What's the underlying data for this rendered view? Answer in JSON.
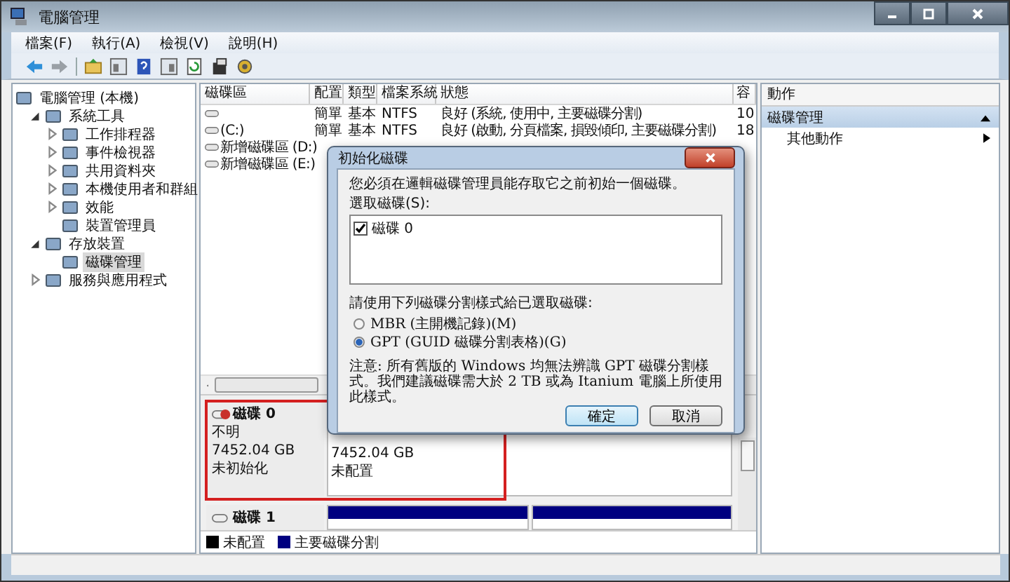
{
  "window": {
    "title": "電腦管理"
  },
  "menu": [
    "檔案(F)",
    "執行(A)",
    "檢視(V)",
    "說明(H)"
  ],
  "tree": [
    {
      "label": "電腦管理 (本機)",
      "selected": false,
      "children": [
        {
          "label": "系統工具",
          "selected": false,
          "expanded": true,
          "children": [
            {
              "label": "工作排程器",
              "selected": false,
              "expanded": false
            },
            {
              "label": "事件檢視器",
              "selected": false,
              "expanded": false
            },
            {
              "label": "共用資料夾",
              "selected": false,
              "expanded": false
            },
            {
              "label": "本機使用者和群組",
              "selected": false,
              "expanded": false
            },
            {
              "label": "效能",
              "selected": false,
              "expanded": false
            },
            {
              "label": "裝置管理員",
              "selected": false
            }
          ]
        },
        {
          "label": "存放裝置",
          "selected": false,
          "expanded": true,
          "children": [
            {
              "label": "磁碟管理",
              "selected": true
            }
          ]
        },
        {
          "label": "服務與應用程式",
          "selected": false,
          "expanded": false
        }
      ]
    }
  ],
  "volumes": {
    "columns": [
      "磁碟區",
      "配置",
      "類型",
      "檔案系統",
      "狀態",
      "容"
    ],
    "rows": [
      {
        "cells": [
          "簡單",
          "基本",
          "NTFS",
          "良好 (系統, 使用中, 主要磁碟分割)",
          "10"
        ]
      },
      {
        "name": "(C:)",
        "cells": [
          "簡單",
          "基本",
          "NTFS",
          "良好 (啟動, 分頁檔案, 損毀傾印, 主要磁碟分割)",
          "18"
        ]
      },
      {
        "name": "新增磁碟區 (D:)"
      },
      {
        "name": "新增磁碟區 (E:)"
      }
    ]
  },
  "disks": [
    {
      "name": "磁碟 0",
      "kind": "uninitialized",
      "lines": [
        "不明",
        "7452.04 GB",
        "未初始化"
      ],
      "partitions": [
        {
          "size": "7452.04 GB",
          "label": "未配置"
        }
      ]
    },
    {
      "name": "磁碟 1",
      "kind": "basic",
      "partitions": [
        {
          "color": "#000080"
        },
        {
          "color": "#000080"
        }
      ]
    }
  ],
  "legend": [
    {
      "label": "未配置",
      "color": "#000000"
    },
    {
      "label": "主要磁碟分割",
      "color": "#000080"
    }
  ],
  "actions": {
    "header": "動作",
    "section": {
      "label": "磁碟管理",
      "expanded": true
    },
    "items": [
      {
        "label": "其他動作"
      }
    ]
  },
  "dialog": {
    "title": "初始化磁碟",
    "message": "您必須在邏輯磁碟管理員能存取它之前初始一個磁碟。",
    "list_label": "選取磁碟(S):",
    "disks": [
      {
        "label": "磁碟 0",
        "checked": true
      }
    ],
    "style_label": "請使用下列磁碟分割樣式給已選取磁碟:",
    "styles": [
      {
        "label": "MBR (主開機記錄)(M)",
        "selected": false
      },
      {
        "label": "GPT (GUID 磁碟分割表格)(G)",
        "selected": true
      }
    ],
    "note": "注意: 所有舊版的 Windows 均無法辨識 GPT 磁碟分割樣式。我們建議磁碟需大於 2 TB 或為 Itanium 電腦上所使用此樣式。",
    "buttons": [
      {
        "label": "確定",
        "default": true
      },
      {
        "label": "取消",
        "default": false
      }
    ]
  }
}
